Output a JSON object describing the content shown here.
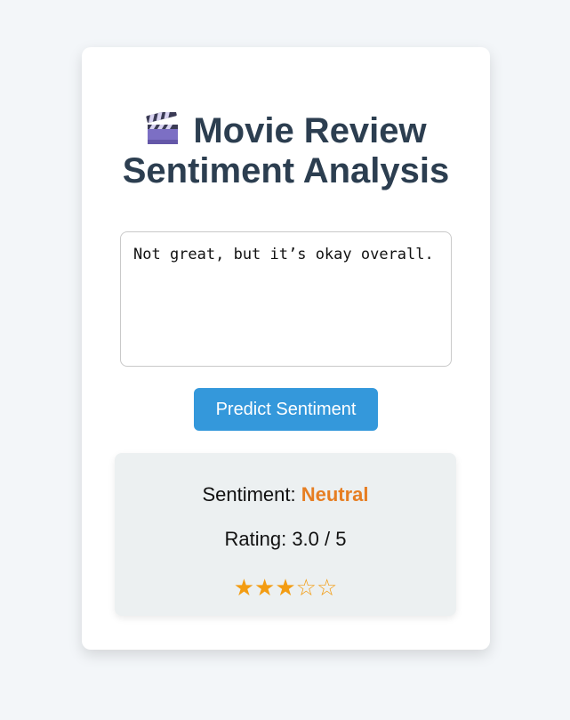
{
  "page": {
    "title": "Movie Review Sentiment Analysis",
    "title_icon": "clapperboard-icon"
  },
  "review": {
    "value": "Not great, but it’s okay overall."
  },
  "actions": {
    "predict_label": "Predict Sentiment"
  },
  "result": {
    "sentiment_label": "Sentiment: ",
    "sentiment_value": "Neutral",
    "rating_text": "Rating: 3.0 / 5",
    "rating_value": 3.0,
    "rating_max": 5,
    "stars": "★★★☆☆"
  },
  "colors": {
    "accent": "#3498db",
    "title": "#2c3e50",
    "neutral": "#e67e22",
    "stars": "#f39c12",
    "background": "#f3f6f9",
    "result_panel": "#ecf0f1"
  }
}
